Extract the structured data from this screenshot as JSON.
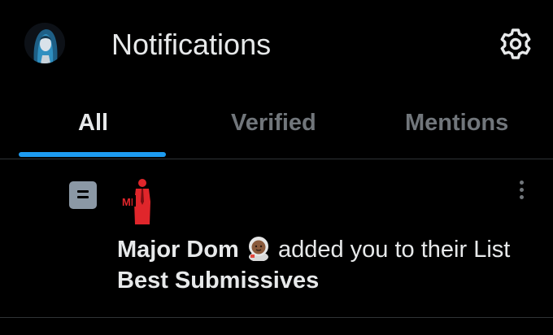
{
  "header": {
    "title": "Notifications",
    "avatar_icon": "user-avatar",
    "settings_icon": "gear-icon"
  },
  "tabs": [
    {
      "label": "All",
      "active": true
    },
    {
      "label": "Verified",
      "active": false
    },
    {
      "label": "Mentions",
      "active": false
    }
  ],
  "notification": {
    "type_icon": "list-icon",
    "avatar_text": "MD",
    "actor": "Major Dom",
    "actor_emoji": "astronaut-emoji",
    "action": " added you to their List ",
    "list_name": "Best Submissives",
    "menu_icon": "more-vertical-icon"
  },
  "colors": {
    "background": "#000000",
    "text_primary": "#e7e9ea",
    "text_secondary": "#71767b",
    "accent": "#1d9bf0",
    "divider": "#2f3336",
    "list_icon": "#8b98a5",
    "md_logo": "#e0262b"
  }
}
